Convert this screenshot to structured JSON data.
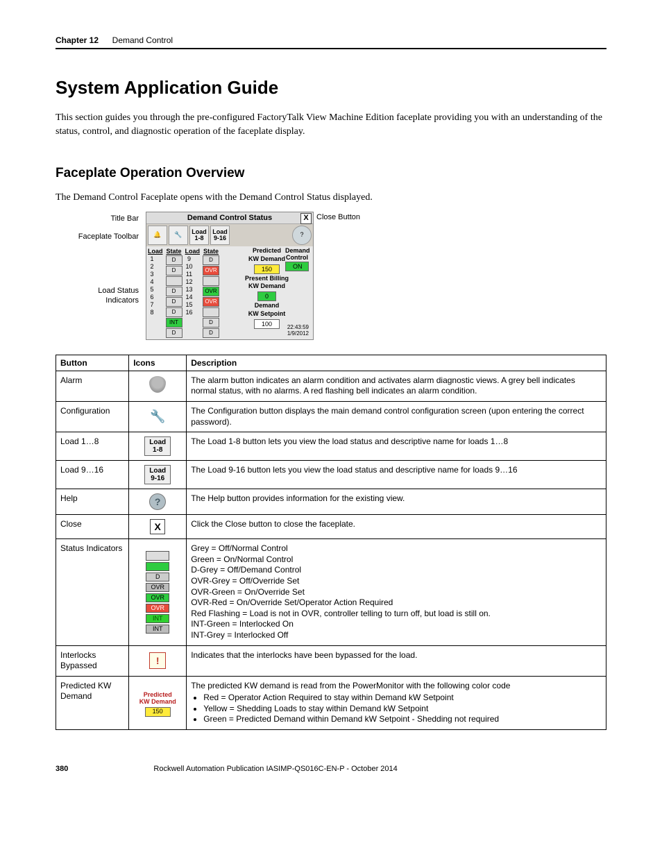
{
  "header": {
    "chapter_label": "Chapter 12",
    "chapter_title": "Demand Control"
  },
  "h1": "System Application Guide",
  "intro": "This section guides you through the pre-configured FactoryTalk View Machine Edition faceplate providing you with an understanding of the status, control, and diagnostic operation of the faceplate display.",
  "h2": "Faceplate Operation Overview",
  "lead": "The Demand Control Faceplate opens with the Demand Control Status displayed.",
  "callouts": {
    "title_bar": "Title Bar",
    "faceplate_toolbar": "Faceplate Toolbar",
    "load_status_indicators_l1": "Load Status",
    "load_status_indicators_l2": "Indicators",
    "close_button": "Close Button"
  },
  "faceplate": {
    "title": "Demand Control Status",
    "close_x": "X",
    "toolbar": {
      "load18_l1": "Load",
      "load18_l2": "1-8",
      "load916_l1": "Load",
      "load916_l2": "9-16",
      "help": "?"
    },
    "cols": {
      "load": "Load",
      "state": "State"
    },
    "left_loads": [
      "1",
      "2",
      "3",
      "4",
      "5",
      "6",
      "7",
      "8"
    ],
    "right_loads": [
      "9",
      "10",
      "11",
      "12",
      "13",
      "14",
      "15",
      "16"
    ],
    "state_d": "D",
    "state_int": "INT",
    "state_ovr": "OVR",
    "predicted_label_l1": "Predicted",
    "predicted_label_l2": "KW Demand",
    "predicted_value": "150",
    "present_label_l1": "Present Billing",
    "present_label_l2": "KW Demand",
    "present_value": "0",
    "setpoint_label_l1": "Demand",
    "setpoint_label_l2": "KW Setpoint",
    "setpoint_value": "100",
    "dc_label_l1": "Demand",
    "dc_label_l2": "Control",
    "dc_value": "ON",
    "time": "22:43:59",
    "date": "1/9/2012"
  },
  "table": {
    "head": {
      "c1": "Button",
      "c2": "Icons",
      "c3": "Description"
    },
    "rows": {
      "alarm": {
        "name": "Alarm",
        "desc": "The alarm button indicates an alarm condition and activates alarm diagnostic views. A grey bell indicates normal status, with no alarms. A red flashing bell indicates an alarm condition."
      },
      "config": {
        "name": "Configuration",
        "desc": "The Configuration button displays the main demand control configuration screen (upon entering the correct password)."
      },
      "load18": {
        "name": "Load 1…8",
        "icon_l1": "Load",
        "icon_l2": "1-8",
        "desc": "The Load 1-8 button lets you view the load status and descriptive name for loads 1…8"
      },
      "load916": {
        "name": "Load 9…16",
        "icon_l1": "Load",
        "icon_l2": "9-16",
        "desc": "The Load 9-16 button lets you view the load status and descriptive name for loads 9…16"
      },
      "help": {
        "name": "Help",
        "icon": "?",
        "desc": "The Help button provides information for the existing view."
      },
      "close": {
        "name": "Close",
        "icon": "X",
        "desc": "Click the Close button to close the faceplate."
      },
      "status": {
        "name": "Status Indicators",
        "icon_d": "D",
        "icon_ovr": "OVR",
        "icon_int": "INT",
        "desc_lines": [
          "Grey = Off/Normal Control",
          "Green = On/Normal Control",
          "D-Grey = Off/Demand Control",
          "OVR-Grey = Off/Override Set",
          "OVR-Green = On/Override Set",
          "OVR-Red = On/Override Set/Operator Action Required",
          "Red Flashing = Load is not in OVR, controller telling to turn off, but load is still on.",
          "INT-Green = Interlocked On",
          "INT-Grey = Interlocked Off"
        ]
      },
      "interlocks": {
        "name": "Interlocks Bypassed",
        "icon": "!",
        "desc": "Indicates that the interlocks have been bypassed for the load."
      },
      "predicted": {
        "name_l1": "Predicted KW",
        "name_l2": "Demand",
        "icon_l1": "Predicted",
        "icon_l2": "KW Demand",
        "icon_val": "150",
        "desc_lead": "The predicted KW demand is read from the PowerMonitor with the following color code",
        "desc_bullets": [
          "Red = Operator Action Required to stay within Demand kW Setpoint",
          "Yellow = Shedding Loads to stay within Demand kW Setpoint",
          "Green = Predicted Demand within Demand kW Setpoint - Shedding not required"
        ]
      }
    }
  },
  "footer": {
    "page": "380",
    "pub": "Rockwell Automation Publication IASIMP-QS016C-EN-P - October 2014"
  }
}
